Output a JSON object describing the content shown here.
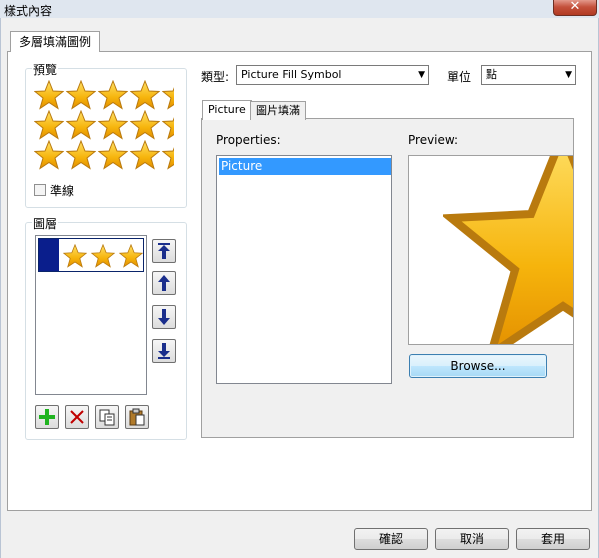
{
  "window": {
    "title": "樣式內容",
    "close_label": "✕"
  },
  "main_tab": {
    "label": "多層填滿圖例"
  },
  "preview_group": {
    "label": "預覽"
  },
  "guides": {
    "label": "準線",
    "checked": false
  },
  "layers_group": {
    "label": "圖層"
  },
  "type_field": {
    "label": "類型:",
    "value": "Picture Fill Symbol"
  },
  "unit_field": {
    "label": "單位",
    "value": "點"
  },
  "sub_tabs": {
    "picture": "Picture",
    "fill": "圖片填滿"
  },
  "properties": {
    "label": "Properties:",
    "items": [
      "Picture"
    ]
  },
  "preview": {
    "label": "Preview:"
  },
  "browse_button": {
    "label": "Browse..."
  },
  "footer": {
    "ok": "確認",
    "cancel": "取消",
    "apply": "套用"
  },
  "colors": {
    "star_fill": "#f6b40c",
    "star_edge": "#b97a0e",
    "layer_swatch": "#0a1e8c",
    "selection": "#3399ff"
  },
  "icons": {
    "move_top": "move-to-top-icon",
    "move_up": "move-up-icon",
    "move_down": "move-down-icon",
    "move_bottom": "move-to-bottom-icon",
    "add": "add-icon",
    "delete": "delete-icon",
    "copy": "copy-icon",
    "paste": "paste-icon"
  }
}
